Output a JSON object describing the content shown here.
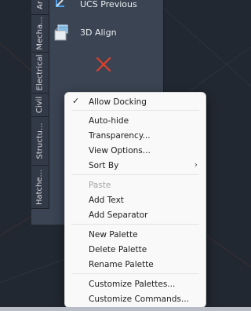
{
  "palette": {
    "tabs": [
      "Ar",
      "Mecha...",
      "Electrical",
      "Civil",
      "Structu...",
      "Hatche..."
    ],
    "tools": [
      {
        "label": "UCS Previous",
        "icon": "ucs-previous-icon"
      },
      {
        "label": "3D Align",
        "icon": "3d-align-icon"
      }
    ],
    "close_icon": "close-x-icon",
    "close_color": "#e0402a"
  },
  "context_menu": {
    "groups": [
      [
        {
          "label": "Allow Docking",
          "checked": true
        }
      ],
      [
        {
          "label": "Auto-hide"
        },
        {
          "label": "Transparency..."
        },
        {
          "label": "View Options..."
        },
        {
          "label": "Sort By",
          "submenu": true
        }
      ],
      [
        {
          "label": "Paste",
          "disabled": true
        },
        {
          "label": "Add Text"
        },
        {
          "label": "Add Separator"
        }
      ],
      [
        {
          "label": "New Palette"
        },
        {
          "label": "Delete Palette"
        },
        {
          "label": "Rename Palette"
        }
      ],
      [
        {
          "label": "Customize Palettes..."
        },
        {
          "label": "Customize Commands..."
        }
      ]
    ]
  }
}
